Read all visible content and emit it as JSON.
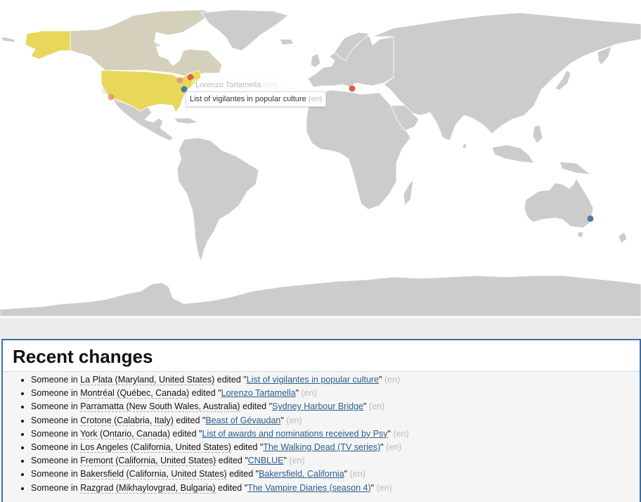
{
  "map": {
    "highlight_colors": {
      "usa": "#e8d85a",
      "canada": "#d4d0bc",
      "default_land": "#cccccc"
    },
    "markers": [
      {
        "place": "La Plata",
        "color": "#4a7aa8",
        "active": true
      },
      {
        "place": "Montréal",
        "color": "#d9604a",
        "active": false
      },
      {
        "place": "York",
        "color": "#e08878",
        "active": false
      },
      {
        "place": "Los Angeles",
        "color": "#e08878",
        "active": false
      },
      {
        "place": "Crotone",
        "color": "#d9604a",
        "active": false
      },
      {
        "place": "Razgrad",
        "color": "#f0c0b8",
        "active": false
      },
      {
        "place": "Parramatta",
        "color": "#4a7aa8",
        "active": false
      }
    ],
    "tooltips": [
      {
        "title": "List of vigilantes in popular culture",
        "lang": "(en)",
        "state": "active"
      },
      {
        "title": "Lorenzo Tartamella",
        "lang": "(en)",
        "state": "fading"
      }
    ]
  },
  "panel": {
    "title": "Recent changes",
    "items": [
      {
        "prefix": "Someone in ",
        "location": "La Plata (Maryland, United States)",
        "verb": " edited \"",
        "article": "List of vigilantes in popular culture",
        "suffix": "\" ",
        "lang": "(en)"
      },
      {
        "prefix": "Someone in ",
        "location": "Montréal (Québec, Canada)",
        "verb": " edited \"",
        "article": "Lorenzo Tartamella",
        "suffix": "\" ",
        "lang": "(en)"
      },
      {
        "prefix": "Someone in ",
        "location": "Parramatta (New South Wales, Australia)",
        "verb": " edited \"",
        "article": "Sydney Harbour Bridge",
        "suffix": "\" ",
        "lang": "(en)"
      },
      {
        "prefix": "Someone in ",
        "location": "Crotone (Calabria, Italy)",
        "verb": " edited \"",
        "article": "Beast of Gévaudan",
        "suffix": "\" ",
        "lang": "(en)"
      },
      {
        "prefix": "Someone in ",
        "location": "York (Ontario, Canada)",
        "verb": " edited \"",
        "article": "List of awards and nominations received by Psy",
        "suffix": "\" ",
        "lang": "(en)"
      },
      {
        "prefix": "Someone in ",
        "location": "Los Angeles (California, United States)",
        "verb": " edited \"",
        "article": "The Walking Dead (TV series)",
        "suffix": "\" ",
        "lang": "(en)"
      },
      {
        "prefix": "Someone in ",
        "location": "Fremont (California, United States)",
        "verb": " edited \"",
        "article": "CNBLUE",
        "suffix": "\" ",
        "lang": "(en)"
      },
      {
        "prefix": "Someone in ",
        "location": "Bakersfield (California, United States)",
        "verb": " edited \"",
        "article": "Bakersfield, California",
        "suffix": "\" ",
        "lang": "(en)"
      },
      {
        "prefix": "Someone in ",
        "location": "Razgrad (Mikhaylovgrad, Bulgaria)",
        "verb": " edited \"",
        "article": "The Vampire Diaries (season 4)",
        "suffix": "\" ",
        "lang": "(en)"
      }
    ]
  }
}
